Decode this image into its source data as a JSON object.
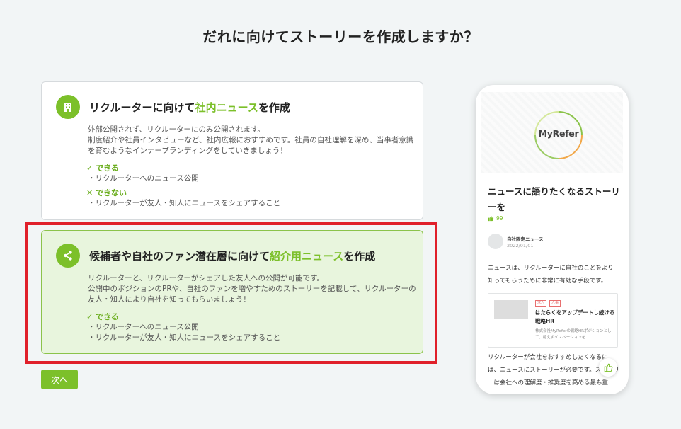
{
  "page_title": "だれに向けてストーリーを作成しますか？",
  "option_internal": {
    "title_pre": "リクルーターに向けて",
    "title_highlight": "社内ニュース",
    "title_post": "を作成",
    "desc_1": "外部公開されず、リクルーターにのみ公開されます。",
    "desc_2": "制度紹介や社員インタビューなど、社内広報におすすめです。社員の自社理解を深め、当事者意識を育むようなインナーブランディングをしていきましょう！",
    "can_mark": "✓",
    "can_label": "できる",
    "can_item": "・リクルーターへのニュース公開",
    "cannot_mark": "✕",
    "cannot_label": "できない",
    "cannot_item": "・リクルーターが友人・知人にニュースをシェアすること",
    "icon": "building-icon"
  },
  "option_referral": {
    "title_pre": "候補者や自社のファン潜在層に向けて",
    "title_highlight": "紹介用ニュース",
    "title_post": "を作成",
    "desc_1": "リクルーターと、リクルーターがシェアした友人への公開が可能です。",
    "desc_2": "公開中のポジションのPRや、自社のファンを増やすためのストーリーを記載して、リクルーターの友人・知人により自社を知ってもらいましょう！",
    "can_mark": "✓",
    "can_label": "できる",
    "can_item_1": "・リクルーターへのニュース公開",
    "can_item_2": "・リクルーターが友人・知人にニュースをシェアすること",
    "icon": "share-icon",
    "selected": true
  },
  "next_button": "次へ",
  "preview": {
    "logo": "MyRefer",
    "title": "ニュースに語りたくなるストーリーを",
    "likes": "99",
    "author": "自社限定ニュース",
    "date": "2022/01/01",
    "body_1": "ニュースは、リクルーターに自社のことをより知ってもらうために非常に有効な手段です。",
    "embed_tag_1": "求人",
    "embed_tag_2": "人事",
    "embed_title": "はたらくをアップデートし続ける戦略HR",
    "embed_desc": "株式会社MyReferの戦略HRポジションとして、絶えずイノベーションを…",
    "body_2": "リクルーターが会社をおすすめしたくなるには、ニュースにストーリーが必要です。ストーリーは会社への理解度・推奨度を高める最も重",
    "colors": {
      "accent": "#7cc02a",
      "highlight_border": "#e0202a"
    }
  }
}
